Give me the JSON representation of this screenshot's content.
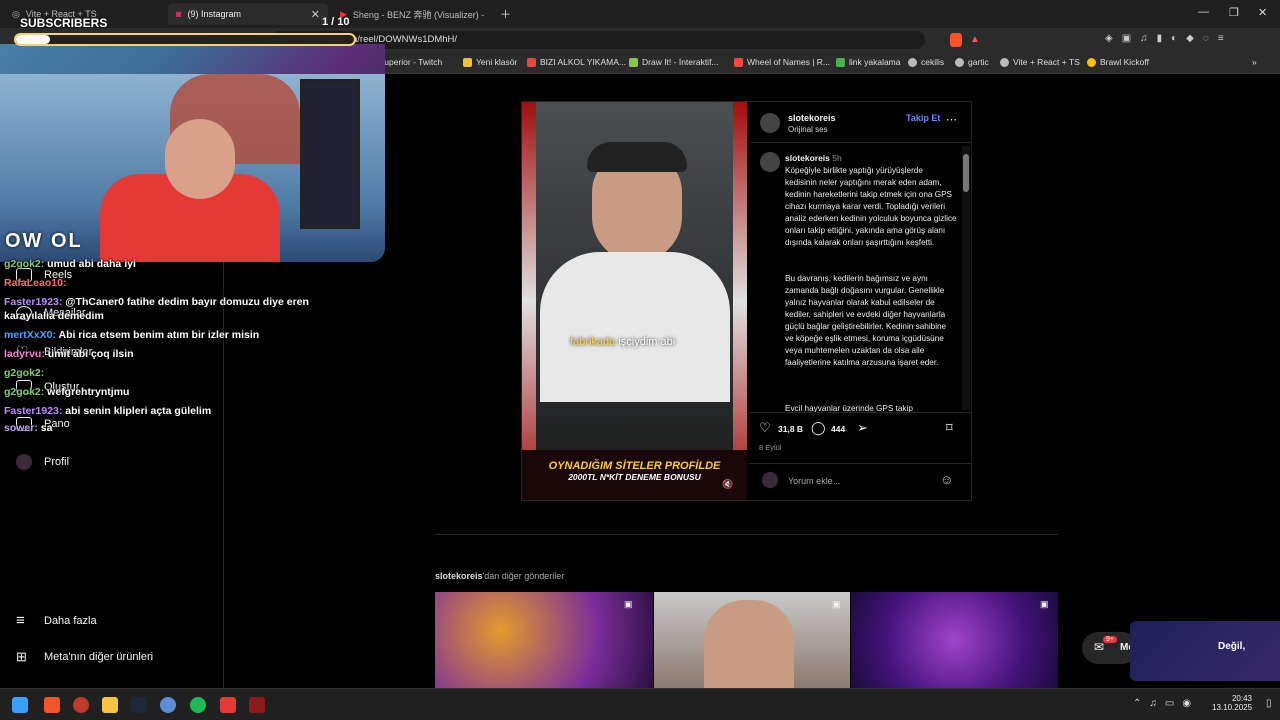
{
  "tabs": [
    {
      "label": "Vite + React + TS",
      "active": false
    },
    {
      "label": "(9) Instagram",
      "active": true
    },
    {
      "label": "Sheng - BENZ 奔驰 (Visualizer) - You",
      "active": false
    }
  ],
  "address": {
    "url": "instagram.com/reel/DOWNWs1DMhH/"
  },
  "bookmarks": [
    "superior - Twitch",
    "Yeni klasör",
    "BIZI ALKOL YIKAMA...",
    "Draw It! - İnteraktif...",
    "Wheel of Names | R...",
    "link yakalama",
    "cekilis",
    "gartic",
    "Vite + React + TS",
    "Brawl Kickoff"
  ],
  "overlay": {
    "subscribers_label": "SUBSCRIBERS",
    "counter": "1 / 10",
    "cam_logo": "OW OL"
  },
  "sidebar": {
    "items": [
      {
        "label": "Reels",
        "icon": "reels-icon"
      },
      {
        "label": "Mesajlar",
        "icon": "messages-icon"
      },
      {
        "label": "Bildirimler",
        "icon": "heart-icon"
      },
      {
        "label": "Oluştur",
        "icon": "plus-icon"
      },
      {
        "label": "Pano",
        "icon": "dashboard-icon"
      },
      {
        "label": "Profil",
        "icon": "avatar-icon"
      },
      {
        "label": "Daha fazla",
        "icon": "menu-icon"
      },
      {
        "label": "Meta'nın diğer ürünleri",
        "icon": "grid-icon"
      }
    ]
  },
  "chat": [
    {
      "user": "g2gok2:",
      "msg": "umud abi daha iyi",
      "color": "#7fd06b"
    },
    {
      "user": "RafaLeao10:",
      "msg": "",
      "color": "#ff6b6b"
    },
    {
      "user": "Faster1923:",
      "msg": "@ThCaner0 fatihe dedim bayır domuzu diye eren",
      "color": "#b78cff"
    },
    {
      "user": "",
      "msg": "karayılalıa demedim",
      "color": "#ffffff"
    },
    {
      "user": "mertXxX0:",
      "msg": "Abi rica etsem benim atım bir izler misin",
      "color": "#4ea3ff"
    },
    {
      "user": "ladyrvu:",
      "msg": "umit abi çoq ilsin",
      "color": "#ff7ad9"
    },
    {
      "user": "g2gok2:",
      "msg": "",
      "color": "#7fd06b"
    },
    {
      "user": "g2gok2:",
      "msg": "wefgrehtryntjmu",
      "color": "#7fd06b"
    },
    {
      "user": "Faster1923:",
      "msg": "abi senin klipleri açta gülelim",
      "color": "#b78cff"
    },
    {
      "user": "sower:",
      "msg": "sa",
      "color": "#c0a0ff"
    }
  ],
  "post": {
    "author": "slotekoreis",
    "audio": "Orijinal ses",
    "follow": "Takip Et",
    "caption_author": "slotekoreis",
    "caption_time": "5h",
    "caption_p1": "Köpeğiyle birlikte yaptığı yürüyüşlerde kedisinin neler yaptığını merak eden adam, kedinin hareketlerini takip etmek için ona GPS cihazı kurmaya karar verdi. Topladığı verileri analiz ederken kedinin yolculuk boyunca gizlice onları takip ettiğini, yakında ama görüş alanı dışında kalarak onları şaşırttığını keşfetti.",
    "caption_p2": "Bu davranış, kedilerin bağımsız ve aynı zamanda bağlı doğasını vurgular. Genellikle yalnız hayvanlar olarak kabul edilseler de kediler, sahipleri ve evdeki diğer hayvanlarla güçlü bağlar geliştirebilirler. Kedinin sahibine ve köpeğe eşlik etmesi, koruma içgüdüsüne veya muhtemelen uzaktan da olsa aile faaliyetlerine katılma arzusuna işaret eder.",
    "caption_p3": "Evcil hayvanlar üzerinde GPS takip",
    "likes": "31,8 B",
    "comments": "444",
    "date": "8 Eylül",
    "comment_placeholder": "Yorum ekle...",
    "video_subtitle_a": "fabrikada",
    "video_subtitle_b": "işçiydim abi",
    "banner_line1": "OYNADIĞIM SİTELER PROFİLDE",
    "banner_line2": "2000TL N*KİT DENEME BONUSU"
  },
  "more": {
    "user": "slotekoreis",
    "suffix": "'dan diğer gönderiler"
  },
  "messages_fab": {
    "label": "Me",
    "badge": "9+",
    "overlay_text": "Değil,"
  },
  "taskbar": {
    "time": "20:43",
    "date": "13.10.2025"
  }
}
